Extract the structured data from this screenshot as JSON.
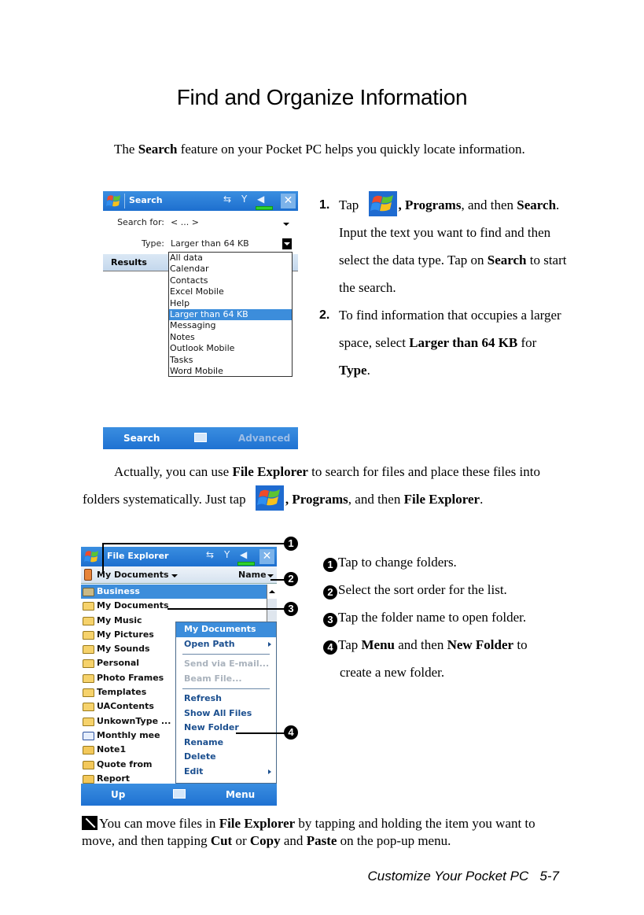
{
  "page": {
    "title": "Find and Organize Information",
    "intro": {
      "pre": "The ",
      "bold": "Search",
      "post": " feature on your Pocket PC helps you quickly locate information."
    },
    "footer": {
      "section": "Customize Your Pocket PC",
      "page_number": "5-7"
    }
  },
  "search_screen": {
    "title": "Search",
    "start_icon": "windows-flag-icon",
    "status_icons": [
      "sync-icon",
      "signal-off-icon",
      "volume-icon",
      "battery-icon"
    ],
    "search_for_label": "Search for:",
    "search_for_value": "< ... >",
    "type_label": "Type:",
    "type_value": "Larger than 64 KB",
    "results_header": "Results",
    "type_options": [
      "All data",
      "Calendar",
      "Contacts",
      "Excel Mobile",
      "Help",
      "Larger than 64 KB",
      "Messaging",
      "Notes",
      "Outlook Mobile",
      "Tasks",
      "Word Mobile"
    ],
    "selected_option": "Larger than 64 KB",
    "softkey_left": "Search",
    "softkey_right": "Advanced",
    "colors": {
      "titlebar": "#1d6fcf",
      "selection": "#3c8ddb"
    }
  },
  "steps": [
    {
      "num": "1.",
      "pre": "Tap ",
      "icon": "windows-flag-icon",
      "b1": ", Programs",
      "mid": ", and then ",
      "b2": "Search",
      "post": ". Input the text you want to find and then select the data type. Tap on ",
      "b3": "Search",
      "end": " to start the search."
    },
    {
      "num": "2.",
      "pre": "To find information that occupies a larger space, select ",
      "b1": "Larger than 64 KB",
      "mid": " for ",
      "b2": "Type",
      "end": "."
    }
  ],
  "file_explorer_intro": {
    "pre": "Actually, you can use ",
    "b1": "File Explorer",
    "mid": " to search for files and place these files into folders systematically. Just tap ",
    "b2": ", Programs",
    "mid2": ", and then ",
    "b3": "File Explorer",
    "end": "."
  },
  "fe_screen": {
    "title": "File Explorer",
    "folder_selector": "My Documents",
    "sort_selector": "Name",
    "items": [
      {
        "name": "Business",
        "icon": "folder-special-icon",
        "selected": true
      },
      {
        "name": "My Documents",
        "icon": "folder-icon"
      },
      {
        "name": "My Music",
        "icon": "folder-icon"
      },
      {
        "name": "My Pictures",
        "icon": "folder-icon"
      },
      {
        "name": "My Sounds",
        "icon": "folder-icon"
      },
      {
        "name": "Personal",
        "icon": "folder-icon"
      },
      {
        "name": "Photo Frames",
        "icon": "folder-icon"
      },
      {
        "name": "Templates",
        "icon": "folder-icon"
      },
      {
        "name": "UAContents",
        "icon": "folder-icon"
      },
      {
        "name": "UnkownType ...",
        "icon": "folder-icon"
      },
      {
        "name": "Monthly mee",
        "icon": "word-doc-icon"
      },
      {
        "name": "Note1",
        "icon": "note-icon"
      },
      {
        "name": "Quote from",
        "icon": "note-icon"
      },
      {
        "name": "Report",
        "icon": "note-icon"
      }
    ],
    "menu": {
      "header": "My Documents",
      "groups": [
        [
          {
            "label": "Open Path",
            "submenu": true
          }
        ],
        [
          {
            "label": "Send via E-mail...",
            "disabled": true
          },
          {
            "label": "Beam File...",
            "disabled": true
          }
        ],
        [
          {
            "label": "Refresh"
          },
          {
            "label": "Show All Files"
          },
          {
            "label": "New Folder"
          },
          {
            "label": "Rename"
          },
          {
            "label": "Delete"
          },
          {
            "label": "Edit",
            "submenu": true
          }
        ]
      ]
    },
    "softkey_left": "Up",
    "softkey_right": "Menu",
    "callouts": [
      "❶",
      "❷",
      "❸",
      "❹"
    ]
  },
  "callout_notes": [
    {
      "marker": "1",
      "text": "Tap to change folders."
    },
    {
      "marker": "2",
      "text": "Select the sort order for the list."
    },
    {
      "marker": "3",
      "text": "Tap the folder name to open folder."
    },
    {
      "marker": "4",
      "pre": "Tap ",
      "b1": "Menu",
      "mid": " and then ",
      "b2": "New Folder",
      "post": " to",
      "cont": "create a new folder."
    }
  ],
  "tip": {
    "icon": "pen-note-icon",
    "pre": "You can move files in ",
    "b1": "File Explorer",
    "mid": " by tapping and holding the item you want to move, and then tapping ",
    "b2": "Cut",
    "mid2": " or ",
    "b3": "Copy",
    "mid3": " and ",
    "b4": "Paste",
    "end": " on the pop-up menu."
  }
}
